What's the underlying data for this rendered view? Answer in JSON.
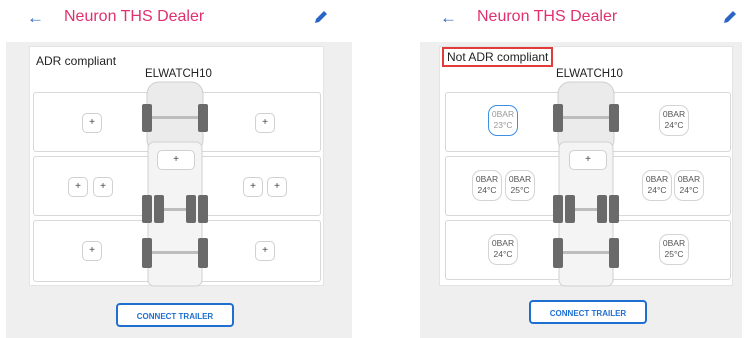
{
  "left": {
    "appbar": {
      "back_icon": "arrow-left-icon",
      "title": "Neuron THS Dealer",
      "edit_icon": "pencil-icon"
    },
    "status": "ADR compliant",
    "vehicle_name": "ELWATCH10",
    "rows": [
      {
        "left": [
          "+"
        ],
        "right": [
          "+"
        ]
      },
      {
        "left": [
          "+",
          "+"
        ],
        "center": "+",
        "right": [
          "+",
          "+"
        ]
      },
      {
        "left": [
          "+"
        ],
        "right": [
          "+"
        ]
      }
    ],
    "connect_label": "CONNECT TRAILER"
  },
  "right": {
    "appbar": {
      "back_icon": "arrow-left-icon",
      "title": "Neuron THS Dealer",
      "edit_icon": "pencil-icon"
    },
    "status": "Not ADR compliant",
    "vehicle_name": "ELWATCH10",
    "rows": [
      {
        "left": [
          {
            "p": "0BAR",
            "t": "23°C"
          }
        ],
        "right": [
          {
            "p": "0BAR",
            "t": "24°C"
          }
        ]
      },
      {
        "left": [
          {
            "p": "0BAR",
            "t": "24°C"
          },
          {
            "p": "0BAR",
            "t": "25°C"
          }
        ],
        "center": "+",
        "right": [
          {
            "p": "0BAR",
            "t": "24°C"
          },
          {
            "p": "0BAR",
            "t": "24°C"
          }
        ]
      },
      {
        "left": [
          {
            "p": "0BAR",
            "t": "24°C"
          }
        ],
        "right": [
          {
            "p": "0BAR",
            "t": "25°C"
          }
        ]
      }
    ],
    "connect_label": "CONNECT TRAILER"
  },
  "colors": {
    "title": "#e0306f",
    "accent": "#1f6fd0",
    "highlight": "#e23b3b",
    "selected_tyre": "#3d8fe0"
  }
}
